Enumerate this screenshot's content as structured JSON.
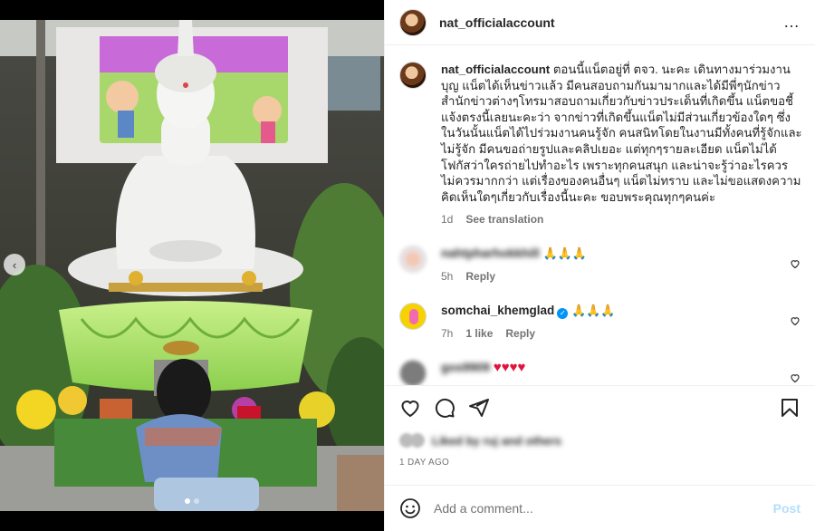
{
  "post": {
    "username": "nat_officialaccount",
    "more_icon": "…",
    "caption_user": "nat_officialaccount",
    "caption_text": "ตอนนี้แน็ตอยู่ที่ ตจว. นะคะ เดินทางมาร่วมงานบุญ แน็ตได้เห็นข่าวแล้ว มีคนสอบถามกันมามากและได้มีพี่ๆนักข่าว สำนักข่าวต่างๆโทรมาสอบถามเกี่ยวกับข่าวประเด็นที่เกิดขึ้น แน็ตขอชี้แจ้งตรงนี้เลยนะคะว่า จากข่าวที่เกิดขึ้นแน็ตไม่มีส่วนเกี่ยวข้องใดๆ ซึ่งในวันนั้นแน็ตได้ไปร่วมงานคนรู้จัก คนสนิทโดยในงานมีทั้งคนที่รู้จักและไม่รู้จัก มีคนขอถ่ายรูปและคลิปเยอะ แต่ทุกๆรายละเอียด แน็ตไม่ได้โฟกัสว่าใครถ่ายไปทำอะไร เพราะทุกคนสนุก และน่าจะรู้ว่าอะไรควร ไม่ควรมากกว่า แต่เรื่องของคนอื่นๆ แน็ตไม่ทราบ และไม่ขอแสดงความคิดเห็นใดๆเกี่ยวกับเรื่องนี้นะคะ ขอบพระคุณทุกๆคนค่ะ",
    "caption_time": "1d",
    "see_translation": "See translation"
  },
  "comments": [
    {
      "user": "nahtpharhokkhill",
      "text": "🙏🙏🙏",
      "time": "5h",
      "likes": "",
      "reply": "Reply"
    },
    {
      "user": "somchai_khemglad",
      "text": "🙏🙏🙏",
      "time": "7h",
      "likes": "1 like",
      "reply": "Reply",
      "verified": "✓"
    },
    {
      "user": "gos9909",
      "text": "♥♥♥♥",
      "time": "",
      "likes": "",
      "reply": ""
    }
  ],
  "likes_text": "Liked by ruj and others",
  "time_ago": "1 DAY AGO",
  "add_comment": {
    "placeholder": "Add a comment...",
    "post": "Post"
  },
  "icons": {
    "like": "heart-icon",
    "comment": "comment-icon",
    "share": "share-icon",
    "save": "bookmark-icon",
    "emoji": "emoji-icon"
  },
  "colors": {
    "accent": "#0095f6",
    "post_disabled": "#b2dffc",
    "meta": "#737373"
  }
}
